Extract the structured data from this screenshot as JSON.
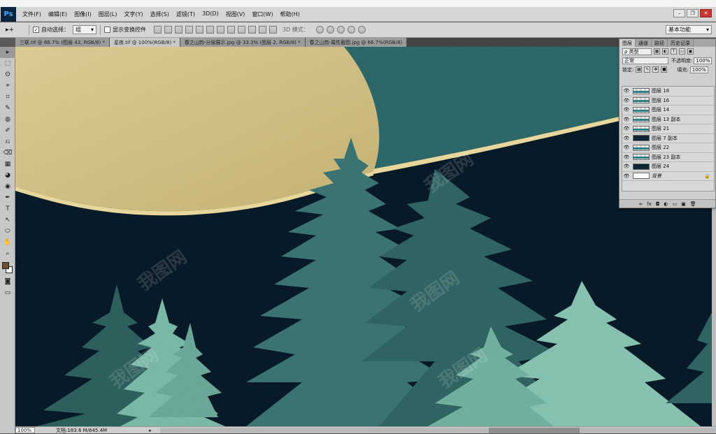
{
  "app": {
    "logo": "Ps"
  },
  "menu": [
    "文件(F)",
    "编辑(E)",
    "图像(I)",
    "图层(L)",
    "文字(Y)",
    "选择(S)",
    "滤镜(T)",
    "3D(D)",
    "视图(V)",
    "窗口(W)",
    "帮助(H)"
  ],
  "window_controls": {
    "minimize": "–",
    "restore": "❐",
    "close": "✕"
  },
  "options": {
    "tool_glyph": "▸+",
    "auto_select_label": "自动选择：",
    "auto_select_value": "组",
    "show_transform_label": "显示变换控件",
    "three_d_mode_label": "3D 模式：",
    "workspace": "基本功能"
  },
  "tabs": [
    "三联.tif @ 66.7% (图层 43, RGB/8) *",
    "星夜.tif @ 100%(RGB/8) *",
    "春之山韵-分层展示.jpg @ 33.3% (图层 2, RGB/8) *",
    "春之山韵-属性截图.jpg @ 66.7%(RGB/8)"
  ],
  "active_tab_index": 1,
  "tools": [
    "▸",
    "⬚",
    "ʘ",
    "⌖",
    "⌗",
    "✎",
    "◍",
    "✐",
    "⎌",
    "⌫",
    "▦",
    "◕",
    "◉",
    "✒",
    "T",
    "↖",
    "⬭",
    "✋",
    "⌕"
  ],
  "colors": {
    "foreground": "#6e4f2e",
    "background": "#ffffff",
    "sky_dark": "#081a27",
    "moon": "#d9c88c",
    "teal": "#3b7a78",
    "tree_light": "#7bbdae"
  },
  "status": {
    "zoom": "100%",
    "doc": "文档:183.6 M/645.4M",
    "arrow": "▸"
  },
  "watermark_text": "我图网",
  "layers_panel": {
    "tabs": [
      "图层",
      "通道",
      "路径",
      "历史记录"
    ],
    "filter_label": "ρ 类型",
    "blend_mode": "正常",
    "opacity_label": "不透明度:",
    "opacity_value": "100%",
    "lock_label": "锁定:",
    "fill_label": "填充:",
    "fill_value": "100%",
    "layers": [
      {
        "name": "图层 18",
        "thumb": "wave"
      },
      {
        "name": "图层 16",
        "thumb": "wave"
      },
      {
        "name": "图层 14",
        "thumb": "wave"
      },
      {
        "name": "图层 13 副本",
        "thumb": "wave"
      },
      {
        "name": "图层 21",
        "thumb": "wave"
      },
      {
        "name": "图层 7 副本",
        "thumb": "dark"
      },
      {
        "name": "图层 22",
        "thumb": "wave"
      },
      {
        "name": "图层 23 副本",
        "thumb": "wave"
      },
      {
        "name": "图层 24",
        "thumb": "dark"
      },
      {
        "name": "背景",
        "thumb": "white",
        "locked": true
      }
    ],
    "footer_icons": [
      "∞",
      "fx",
      "◘",
      "◐",
      "▭",
      "▣",
      "🗑"
    ]
  }
}
